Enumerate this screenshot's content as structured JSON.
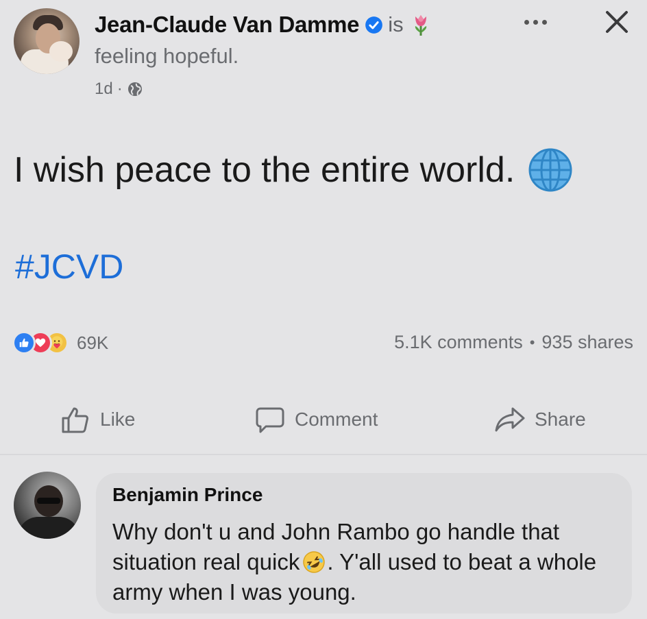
{
  "post": {
    "author": "Jean-Claude Van Damme",
    "status_prefix": "is",
    "feeling": "feeling hopeful.",
    "timestamp": "1d",
    "meta_separator": "·",
    "body_text": "I wish peace to the entire world.",
    "hashtag": "#JCVD"
  },
  "engagement": {
    "reaction_count": "69K",
    "comments": "5.1K comments",
    "separator": "•",
    "shares": "935 shares"
  },
  "actions": {
    "like_label": "Like",
    "comment_label": "Comment",
    "share_label": "Share"
  },
  "comment": {
    "author": "Benjamin Prince",
    "text_part1": "Why don't u and John Rambo go handle that situation real quick",
    "text_part2": ". Y'all used to beat a whole army when I was young."
  },
  "icons": {
    "verified": "verified-badge-icon",
    "feeling": "tulip-icon",
    "privacy": "globe-icon",
    "more": "more-options-icon",
    "close": "close-icon",
    "globe_emoji": "globe-meridians-icon",
    "reactions": [
      "like-reaction-icon",
      "love-reaction-icon",
      "care-reaction-icon"
    ],
    "laugh_emoji": "rolling-laughing-icon"
  },
  "colors": {
    "background": "#e4e4e6",
    "hashtag": "#1d6ed8",
    "like": "#2d7ff2",
    "love": "#ee3d57",
    "care": "#f2c143",
    "verified": "#1877f2"
  }
}
